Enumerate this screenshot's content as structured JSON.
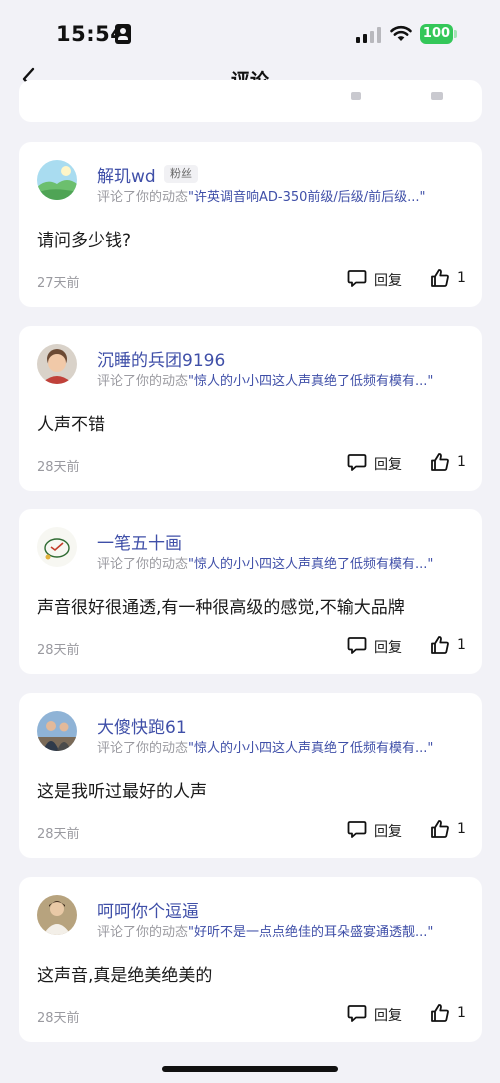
{
  "status_bar": {
    "time": "15:54",
    "battery": "100"
  },
  "nav": {
    "title": "评论"
  },
  "comments": [
    {
      "username": "解玑wd",
      "badge": "粉丝",
      "prefix": "评论了你的动态",
      "quote": "\"许英调音响AD-350前级/后级/前后级...\"",
      "text": "请问多少钱?",
      "date": "27天前",
      "reply_label": "回复",
      "likes": "1"
    },
    {
      "username": "沉睡的兵团9196",
      "badge": "",
      "prefix": "评论了你的动态",
      "quote": "\"惊人的小小四这人声真绝了低频有模有...\"",
      "text": "人声不错",
      "date": "28天前",
      "reply_label": "回复",
      "likes": "1"
    },
    {
      "username": "一笔五十画",
      "badge": "",
      "prefix": "评论了你的动态",
      "quote": "\"惊人的小小四这人声真绝了低频有模有...\"",
      "text": "声音很好很通透,有一种很高级的感觉,不输大品牌",
      "date": "28天前",
      "reply_label": "回复",
      "likes": "1"
    },
    {
      "username": "大傻快跑61",
      "badge": "",
      "prefix": "评论了你的动态",
      "quote": "\"惊人的小小四这人声真绝了低频有模有...\"",
      "text": "这是我听过最好的人声",
      "date": "28天前",
      "reply_label": "回复",
      "likes": "1"
    },
    {
      "username": "呵呵你个逗逼",
      "badge": "",
      "prefix": "评论了你的动态",
      "quote": "\"好听不是一点点绝佳的耳朵盛宴通透靓...\"",
      "text": "这声音,真是绝美绝美的",
      "date": "28天前",
      "reply_label": "回复",
      "likes": "1"
    }
  ]
}
